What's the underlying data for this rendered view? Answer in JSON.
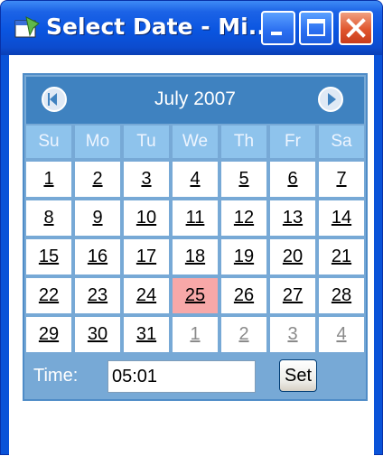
{
  "window": {
    "title": "Select Date - Mi...",
    "icon": "window-app-icon",
    "minimize_icon": "minimize-icon",
    "maximize_icon": "maximize-icon",
    "close_icon": "close-icon"
  },
  "calendar": {
    "month_title": "July 2007",
    "prev_icon": "chevron-left-circle-icon",
    "next_icon": "chevron-right-circle-icon",
    "weekdays": [
      "Su",
      "Mo",
      "Tu",
      "We",
      "Th",
      "Fr",
      "Sa"
    ],
    "weeks": [
      [
        {
          "label": "1"
        },
        {
          "label": "2"
        },
        {
          "label": "3"
        },
        {
          "label": "4"
        },
        {
          "label": "5"
        },
        {
          "label": "6"
        },
        {
          "label": "7"
        }
      ],
      [
        {
          "label": "8"
        },
        {
          "label": "9"
        },
        {
          "label": "10"
        },
        {
          "label": "11"
        },
        {
          "label": "12"
        },
        {
          "label": "13"
        },
        {
          "label": "14"
        }
      ],
      [
        {
          "label": "15"
        },
        {
          "label": "16"
        },
        {
          "label": "17"
        },
        {
          "label": "18"
        },
        {
          "label": "19"
        },
        {
          "label": "20"
        },
        {
          "label": "21"
        }
      ],
      [
        {
          "label": "22"
        },
        {
          "label": "23"
        },
        {
          "label": "24"
        },
        {
          "label": "25",
          "today": true
        },
        {
          "label": "26"
        },
        {
          "label": "27"
        },
        {
          "label": "28"
        }
      ],
      [
        {
          "label": "29"
        },
        {
          "label": "30"
        },
        {
          "label": "31"
        },
        {
          "label": "1",
          "other": true
        },
        {
          "label": "2",
          "other": true
        },
        {
          "label": "3",
          "other": true
        },
        {
          "label": "4",
          "other": true
        }
      ]
    ],
    "colors": {
      "header_bg": "#3f82c0",
      "weekday_bg": "#8ec3ec",
      "panel_bg": "#77a9d6",
      "today_bg": "#f7a8a8",
      "other_month_text": "#8a8a8a"
    }
  },
  "time": {
    "label": "Time:",
    "value": "05:01",
    "set_label": "Set"
  }
}
